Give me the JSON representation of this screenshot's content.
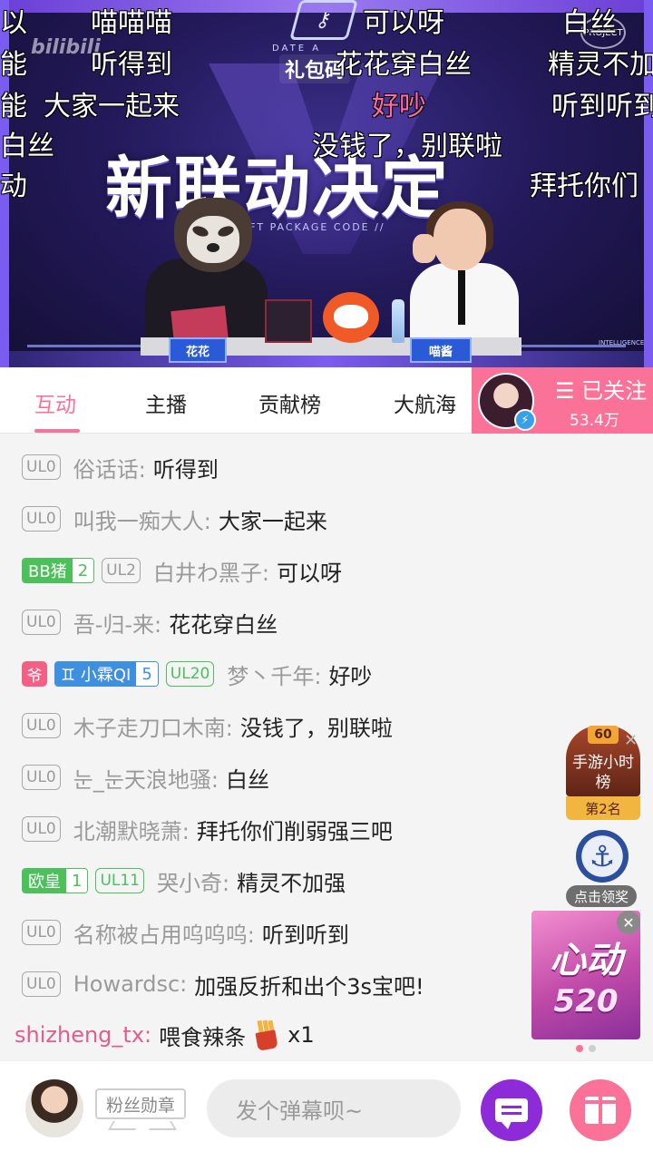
{
  "video": {
    "title": "新联动决定",
    "gift_tag": "礼包码",
    "watermark": "bilibili",
    "stream_badge": "PROJECT",
    "date_text": "DATE A",
    "gift_code_text": "IFT PACKAGE CODE //",
    "intelligence_text": "INTELLIGENCE",
    "nameplates": [
      "花花",
      "喵酱"
    ],
    "danmaku": [
      {
        "text": "以",
        "color": "white"
      },
      {
        "text": "喵喵喵",
        "color": "white"
      },
      {
        "text": "可以呀",
        "color": "white"
      },
      {
        "text": "白丝",
        "color": "white"
      },
      {
        "text": "能",
        "color": "white"
      },
      {
        "text": "听得到",
        "color": "white"
      },
      {
        "text": "花花穿白丝",
        "color": "white"
      },
      {
        "text": "精灵不加",
        "color": "white"
      },
      {
        "text": "能",
        "color": "white"
      },
      {
        "text": "大家一起来",
        "color": "white"
      },
      {
        "text": "好吵",
        "color": "pink"
      },
      {
        "text": "听到听到",
        "color": "white"
      },
      {
        "text": "白丝",
        "color": "white"
      },
      {
        "text": "没钱了，别联啦",
        "color": "white"
      },
      {
        "text": "动",
        "color": "white"
      },
      {
        "text": "拜托你们",
        "color": "white"
      }
    ]
  },
  "tabs": [
    "互动",
    "主播",
    "贡献榜",
    "大航海"
  ],
  "active_tab": "互动",
  "follow": {
    "label": "☰ 已关注",
    "count": "53.4万"
  },
  "chat": [
    {
      "ul": "UL0",
      "user": "俗话话:",
      "text": "听得到"
    },
    {
      "ul": "UL0",
      "user": "叫我一痴大人:",
      "text": "大家一起来"
    },
    {
      "medal": "BB猪",
      "medal_lv": "2",
      "ul": "UL2",
      "user": "白井わ黑子:",
      "text": "可以呀"
    },
    {
      "ul": "UL0",
      "user": "吾-归-来:",
      "text": "花花穿白丝"
    },
    {
      "ye": "爷",
      "medal": "♊ 小霖QI",
      "medal_lv": "5",
      "ul": "UL20",
      "user": "梦丶千年:",
      "text": "好吵"
    },
    {
      "ul": "UL0",
      "user": "木子走刀口木南:",
      "text": "没钱了，别联啦"
    },
    {
      "ul": "UL0",
      "user": "눈_눈天浪地骚:",
      "text": "白丝"
    },
    {
      "ul": "UL0",
      "user": "北潮默晓萧:",
      "text": "拜托你们削弱强三吧"
    },
    {
      "medal": "欧皇",
      "medal_lv": "1",
      "ul": "UL11",
      "user": "哭小奇:",
      "text": "精灵不加强"
    },
    {
      "ul": "UL0",
      "user": "名称被占用呜呜呜:",
      "text": "听到听到"
    },
    {
      "ul": "UL0",
      "user": "Howardsc:",
      "text": "加强反折和出个3s宝吧!"
    }
  ],
  "gift_message": {
    "user": "shizheng_tx:",
    "action": "喂食辣条",
    "count": "x1"
  },
  "widgets": {
    "rank_badge": "60",
    "rank_title": "手游小时榜",
    "rank_place": "第2名",
    "reward_label": "点击领奖",
    "promo_line1": "心动",
    "promo_line2": "520"
  },
  "bottom": {
    "fans_medal": "粉丝勋章",
    "input_placeholder": "发个弹幕呗~"
  },
  "colors": {
    "accent": "#fb7299",
    "green": "#4cc05a",
    "blue": "#3f8fe0",
    "purple": "#8e2bd8"
  }
}
